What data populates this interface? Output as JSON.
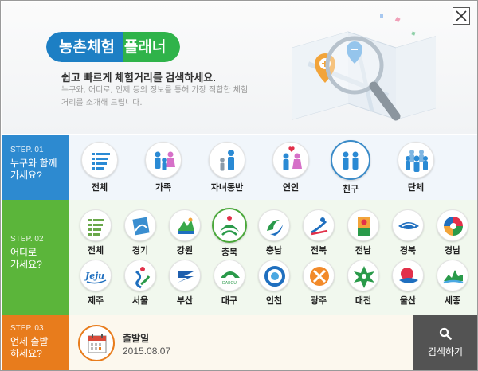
{
  "header": {
    "title_part1": "농촌체험",
    "title_part2": "플래너",
    "tagline": "쉽고 빠르게 체험거리를 검색하세요.",
    "description": "누구와, 어디로, 언제 등의 정보를 통해 가장 적합한 체험거리를 소개해 드립니다.",
    "close_icon": "close-icon"
  },
  "step1": {
    "num": "STEP. 01",
    "question_line1": "누구와 함께",
    "question_line2": "가세요?",
    "items": [
      {
        "label": "전체",
        "icon": "list-icon"
      },
      {
        "label": "가족",
        "icon": "family-icon"
      },
      {
        "label": "자녀동반",
        "icon": "parent-child-icon"
      },
      {
        "label": "연인",
        "icon": "couple-icon"
      },
      {
        "label": "친구",
        "icon": "friends-icon",
        "selected": true
      },
      {
        "label": "단체",
        "icon": "group-icon"
      }
    ]
  },
  "step2": {
    "num": "STEP. 02",
    "question_line1": "어디로",
    "question_line2": "가세요?",
    "items": [
      {
        "label": "전체",
        "icon": "list-icon"
      },
      {
        "label": "경기",
        "icon": "gyeonggi-logo-icon"
      },
      {
        "label": "강원",
        "icon": "gangwon-logo-icon"
      },
      {
        "label": "충북",
        "icon": "chungbuk-logo-icon",
        "selected": true
      },
      {
        "label": "충남",
        "icon": "chungnam-logo-icon"
      },
      {
        "label": "전북",
        "icon": "jeonbuk-logo-icon"
      },
      {
        "label": "전남",
        "icon": "jeonnam-logo-icon"
      },
      {
        "label": "경북",
        "icon": "gyeongbuk-logo-icon"
      },
      {
        "label": "경남",
        "icon": "gyeongnam-logo-icon"
      },
      {
        "label": "제주",
        "icon": "jeju-logo-icon"
      },
      {
        "label": "서울",
        "icon": "seoul-logo-icon"
      },
      {
        "label": "부산",
        "icon": "busan-logo-icon"
      },
      {
        "label": "대구",
        "icon": "daegu-logo-icon"
      },
      {
        "label": "인천",
        "icon": "incheon-logo-icon"
      },
      {
        "label": "광주",
        "icon": "gwangju-logo-icon"
      },
      {
        "label": "대전",
        "icon": "daejeon-logo-icon"
      },
      {
        "label": "울산",
        "icon": "ulsan-logo-icon"
      },
      {
        "label": "세종",
        "icon": "sejong-logo-icon"
      }
    ]
  },
  "step3": {
    "num": "STEP. 03",
    "question_line1": "언제 출발",
    "question_line2": "하세요?",
    "depart_label": "출발일",
    "depart_date": "2015.08.07",
    "calendar_icon": "calendar-icon",
    "search_label": "검색하기",
    "search_icon": "search-icon"
  },
  "colors": {
    "step1": "#2d8ad0",
    "step2": "#5bb53a",
    "step3": "#e87c1c",
    "title_blue": "#1d7fc4",
    "title_green": "#2fb34a",
    "search_button": "#535353"
  }
}
